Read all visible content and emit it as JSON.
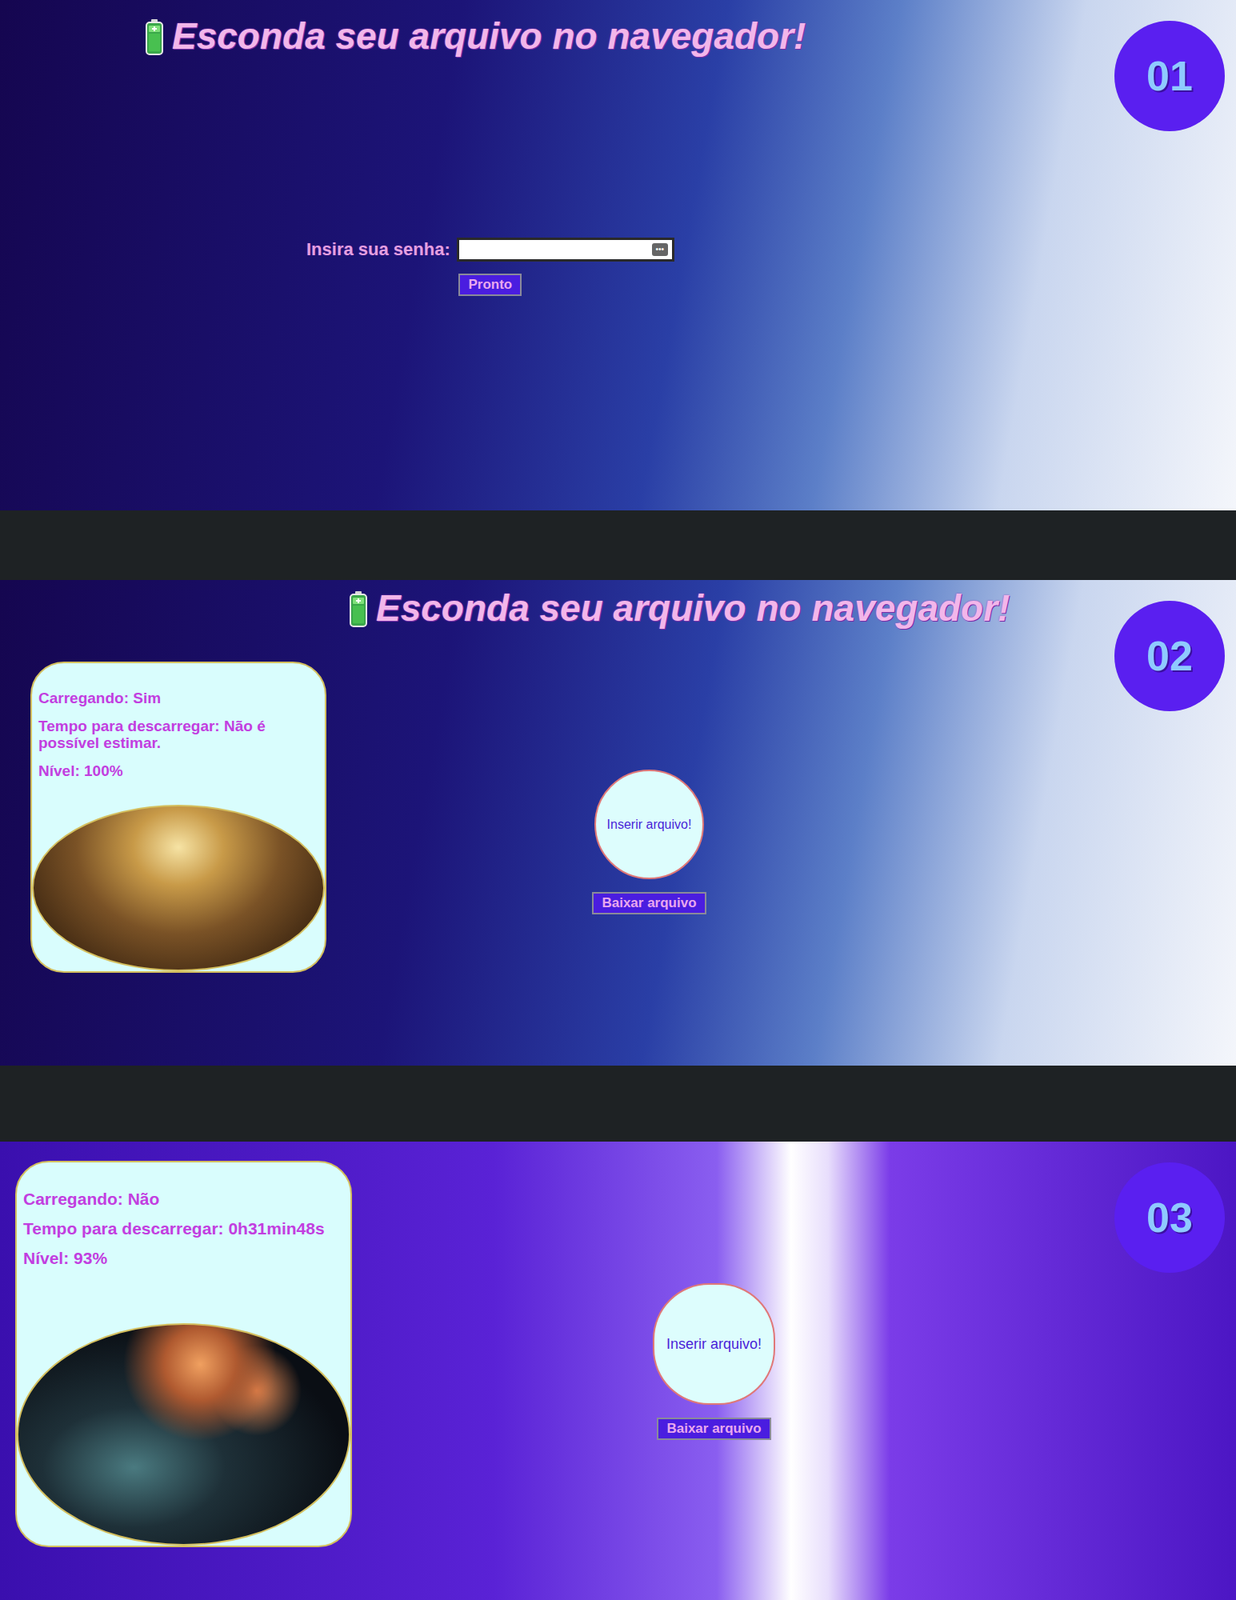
{
  "panels": [
    {
      "kind": "login",
      "badge": "01",
      "title": "Esconda seu arquivo no navegador!",
      "password_label": "Insira sua senha:",
      "submit": "Pronto"
    },
    {
      "kind": "app",
      "badge": "02",
      "title": "Esconda seu arquivo no navegador!",
      "status": [
        "Carregando: Sim",
        "Tempo para descarregar: Não é possível estimar.",
        "Nível: 100%"
      ],
      "upload": "Inserir arquivo!",
      "download": "Baixar arquivo"
    },
    {
      "kind": "app",
      "badge": "03",
      "status": [
        "Carregando: Não",
        "Tempo para descarregar: 0h31min48s",
        "Nível: 93%"
      ],
      "upload": "Inserir arquivo!",
      "download": "Baixar arquivo"
    }
  ]
}
